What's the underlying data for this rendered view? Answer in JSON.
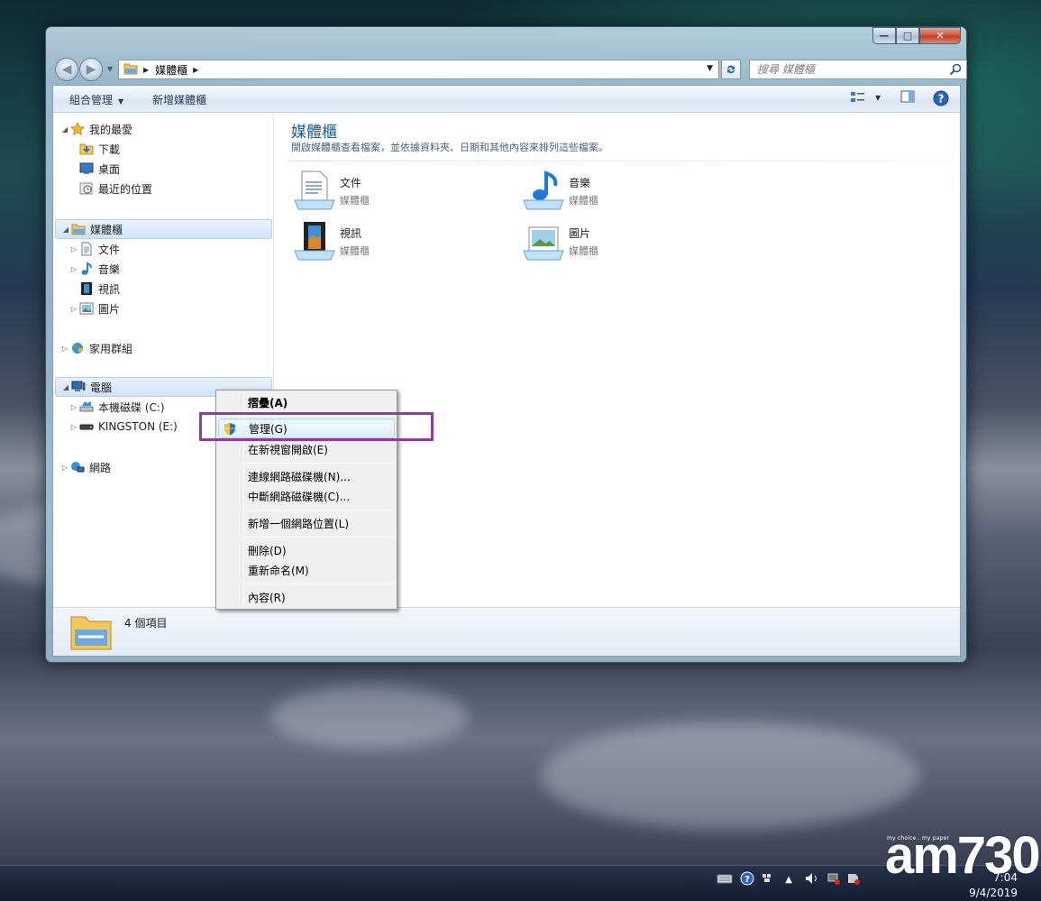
{
  "window": {
    "address": {
      "crumbs": [
        "媒體櫃"
      ]
    },
    "search": {
      "placeholder": "搜尋 媒體櫃"
    },
    "caption_buttons": {
      "minimize": "—",
      "maximize": "□",
      "close": "✕"
    }
  },
  "toolbar": {
    "organize_label": "組合管理",
    "new_library_label": "新增媒體櫃"
  },
  "sidebar": {
    "favorites": {
      "label": "我的最愛",
      "items": [
        "下載",
        "桌面",
        "最近的位置"
      ]
    },
    "libraries": {
      "label": "媒體櫃",
      "items": [
        "文件",
        "音樂",
        "視訊",
        "圖片"
      ]
    },
    "homegroup": {
      "label": "家用群組"
    },
    "computer": {
      "label": "電腦",
      "items": [
        "本機磁碟 (C:)",
        "KINGSTON (E:)"
      ]
    },
    "network": {
      "label": "網路"
    }
  },
  "main": {
    "title": "媒體櫃",
    "description": "開啟媒體櫃查看檔案，並依據資料夾、日期和其他內容來排列這些檔案。",
    "tiles": [
      {
        "name": "文件",
        "type": "媒體櫃"
      },
      {
        "name": "音樂",
        "type": "媒體櫃"
      },
      {
        "name": "視訊",
        "type": "媒體櫃"
      },
      {
        "name": "圖片",
        "type": "媒體櫃"
      }
    ]
  },
  "details": {
    "count": "4 個項目"
  },
  "context_menu": {
    "items": [
      {
        "label": "摺疊(A)"
      },
      {
        "label": "管理(G)"
      },
      {
        "label": "在新視窗開啟(E)"
      },
      {
        "label": "連線網路磁碟機(N)..."
      },
      {
        "label": "中斷網路磁碟機(C)..."
      },
      {
        "label": "新增一個網路位置(L)"
      },
      {
        "label": "刪除(D)"
      },
      {
        "label": "重新命名(M)"
      },
      {
        "label": "內容(R)"
      }
    ],
    "highlighted": "管理(G)",
    "highlight_color": "#8e3e98"
  },
  "taskbar": {
    "time": "7:04",
    "date": "9/4/2019"
  },
  "watermark": {
    "tag": "my choice . my paper",
    "brand": "am730"
  },
  "colors": {
    "accent": "#1e5a8c",
    "selection": "#cfe3f9"
  }
}
